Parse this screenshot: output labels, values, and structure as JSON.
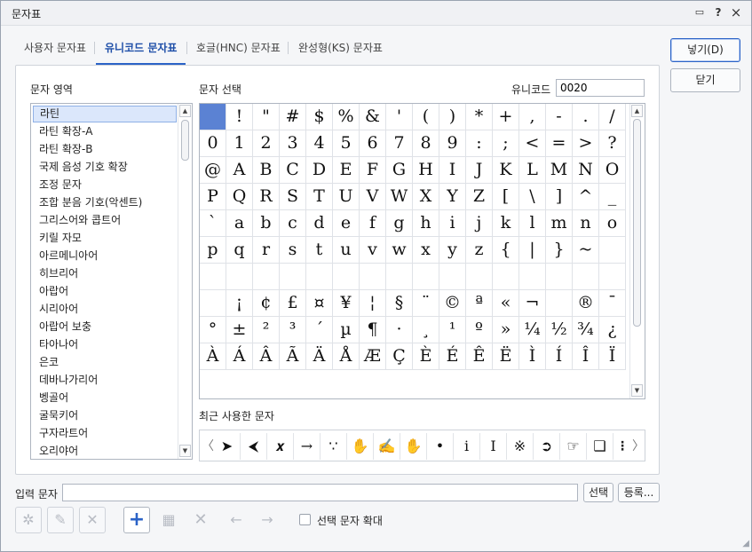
{
  "window": {
    "title": "문자표",
    "help": "?",
    "close": "×",
    "chat": "▭"
  },
  "tabs": [
    {
      "label": "사용자 문자표"
    },
    {
      "label": "유니코드 문자표"
    },
    {
      "label": "호글(HNC) 문자표"
    },
    {
      "label": "완성형(KS) 문자표"
    }
  ],
  "area_label": "문자 영역",
  "select_label": "문자 선택",
  "unicode_label": "유니코드",
  "unicode_value": "0020",
  "areas": [
    "라틴",
    "라틴 확장-A",
    "라틴 확장-B",
    "국제 음성 기호 확장",
    "조정 문자",
    "조합 분음 기호(악센트)",
    "그리스어와 콥트어",
    "키릴 자모",
    "아르메니아어",
    "히브리어",
    "아랍어",
    "시리아어",
    "아랍어 보충",
    "타아나어",
    "은코",
    "데바나가리어",
    "벵골어",
    "굴묵키어",
    "구자라트어",
    "오리야어"
  ],
  "grid_rows": [
    [
      " ",
      "!",
      "\"",
      "#",
      "$",
      "%",
      "&",
      "'",
      "(",
      ")",
      "*",
      "+",
      ",",
      "-",
      ".",
      "/"
    ],
    [
      "0",
      "1",
      "2",
      "3",
      "4",
      "5",
      "6",
      "7",
      "8",
      "9",
      ":",
      ";",
      "<",
      "=",
      ">",
      "?"
    ],
    [
      "@",
      "A",
      "B",
      "C",
      "D",
      "E",
      "F",
      "G",
      "H",
      "I",
      "J",
      "K",
      "L",
      "M",
      "N",
      "O"
    ],
    [
      "P",
      "Q",
      "R",
      "S",
      "T",
      "U",
      "V",
      "W",
      "X",
      "Y",
      "Z",
      "[",
      "\\",
      "]",
      "^",
      "_"
    ],
    [
      "`",
      "a",
      "b",
      "c",
      "d",
      "e",
      "f",
      "g",
      "h",
      "i",
      "j",
      "k",
      "l",
      "m",
      "n",
      "o"
    ],
    [
      "p",
      "q",
      "r",
      "s",
      "t",
      "u",
      "v",
      "w",
      "x",
      "y",
      "z",
      "{",
      "|",
      "}",
      "~",
      ""
    ],
    [
      "",
      "",
      "",
      "",
      "",
      "",
      "",
      "",
      "",
      "",
      "",
      "",
      "",
      "",
      "",
      ""
    ],
    [
      "",
      "¡",
      "¢",
      "£",
      "¤",
      "¥",
      "¦",
      "§",
      "¨",
      "©",
      "ª",
      "«",
      "¬",
      "",
      "®",
      "¯"
    ],
    [
      "°",
      "±",
      "²",
      "³",
      "´",
      "µ",
      "¶",
      "·",
      "¸",
      "¹",
      "º",
      "»",
      "¼",
      "½",
      "¾",
      "¿"
    ],
    [
      "À",
      "Á",
      "Â",
      "Ã",
      "Ä",
      "Å",
      "Æ",
      "Ç",
      "È",
      "É",
      "Ê",
      "Ë",
      "Ì",
      "Í",
      "Î",
      "Ï"
    ]
  ],
  "recent_label": "최근 사용한 문자",
  "recent": [
    "➤",
    "⮜",
    "𝒙",
    "→",
    "∵",
    "✋",
    "✍",
    "✋",
    "•",
    "i",
    "Ⅰ",
    "※",
    "➲",
    "☞",
    "❑"
  ],
  "recent_more": "⋮",
  "recent_prev": "〈",
  "recent_next": "〉",
  "buttons": {
    "insert": "넣기(D)",
    "close": "닫기",
    "select": "선택",
    "register": "등록..."
  },
  "input_label": "입력 문자",
  "input_value": "",
  "zoom_label": "선택 문자 확대",
  "colors": {
    "accent": "#2b63c7",
    "selected_cell": "#5b82d3",
    "selected_list": "#dbe7fb"
  }
}
